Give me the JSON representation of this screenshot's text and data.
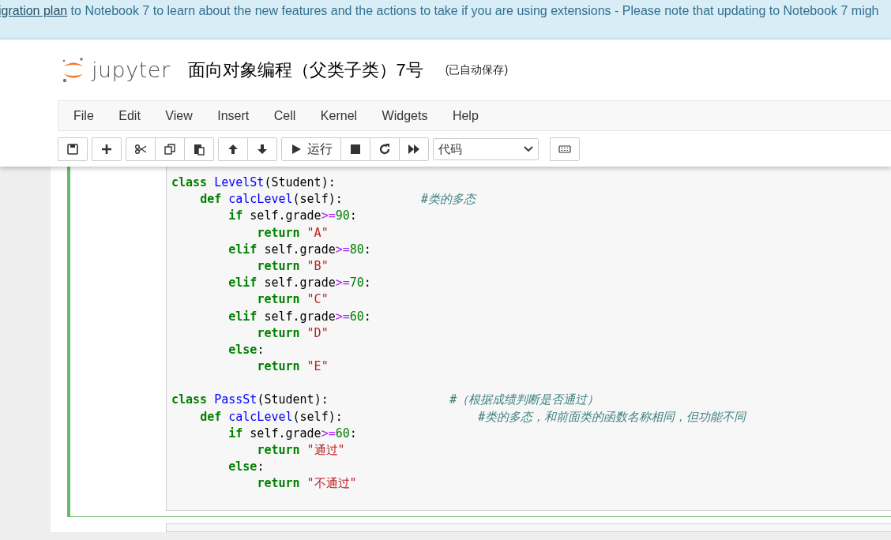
{
  "banner": {
    "link": "igration plan",
    "text": " to Notebook 7 to learn about the new features and the actions to take if you are using extensions - Please note that updating to Notebook 7 migh"
  },
  "header": {
    "logo_text": "jupyter",
    "notebook_title": "面向对象编程（父类子类）7号",
    "save_status": "(已自动保存)"
  },
  "menu": [
    "File",
    "Edit",
    "View",
    "Insert",
    "Cell",
    "Kernel",
    "Widgets",
    "Help"
  ],
  "toolbar": {
    "run_label": "运行",
    "cell_type": "代码"
  },
  "cell": {
    "selected": true,
    "blocks": [
      [
        {
          "code": "class LevelSt(Student):"
        },
        {
          "code": "    def calcLevel(self):           ",
          "comment": "#类的多态"
        },
        {
          "code": "        if self.grade>=90:"
        },
        {
          "code": "            return \"A\""
        },
        {
          "code": "        elif self.grade>=80:"
        },
        {
          "code": "            return \"B\""
        },
        {
          "code": "        elif self.grade>=70:"
        },
        {
          "code": "            return \"C\""
        },
        {
          "code": "        elif self.grade>=60:"
        },
        {
          "code": "            return \"D\""
        },
        {
          "code": "        else:"
        },
        {
          "code": "            return \"E\""
        }
      ],
      [
        {
          "code": "class PassSt(Student):                 ",
          "comment": "#（根据成绩判断是否通过）"
        },
        {
          "code": "    def calcLevel(self):                   ",
          "comment": "#类的多态，和前面类的函数名称相同，但功能不同"
        },
        {
          "code": "        if self.grade>=60:"
        },
        {
          "code": "            return \"通过\""
        },
        {
          "code": "        else:"
        },
        {
          "code": "            return \"不通过\""
        }
      ]
    ]
  }
}
